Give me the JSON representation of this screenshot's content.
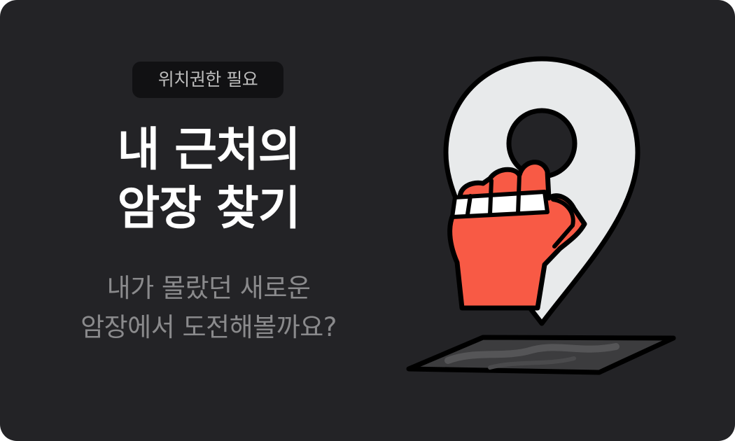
{
  "badge": {
    "label": "위치권한 필요"
  },
  "title": {
    "line1": "내 근처의",
    "line2": "암장 찾기"
  },
  "subtitle": {
    "line1": "내가 몰랐던 새로운",
    "line2": "암장에서 도전해볼까요?"
  },
  "illustration": {
    "icons": [
      "map-pin-icon",
      "hand-icon",
      "map-plane-icon"
    ],
    "colors": {
      "background": "#232326",
      "pin": "#e8eaeb",
      "hand": "#f85a45",
      "map": "#3c3c3e",
      "outline": "#000000"
    }
  }
}
